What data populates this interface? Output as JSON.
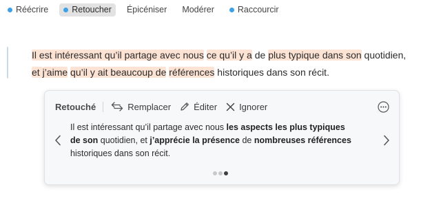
{
  "toolbar": {
    "tabs": [
      {
        "label": "Réécrire",
        "dot": true
      },
      {
        "label": "Retoucher",
        "dot": true,
        "active": true
      },
      {
        "label": "Épicéniser",
        "dot": false
      },
      {
        "label": "Modérer",
        "dot": false
      },
      {
        "label": "Raccourcir",
        "dot": true
      }
    ]
  },
  "paragraph": {
    "l1": {
      "a": "Il est intéressant qu’il partage avec nous",
      "sp": " ",
      "h1": "ce qu’il y a",
      "b": " de ",
      "h2": "plus typique dans son",
      "c": " quotidien,"
    },
    "l2": {
      "a": "et ",
      "h1": "j’aime",
      "b": " ",
      "h2": "qu’il y ait beaucoup de",
      "c": " ",
      "h3": "références",
      "d": " historiques dans son récit."
    }
  },
  "card": {
    "title": "Retouché",
    "actions": {
      "replace": "Remplacer",
      "edit": "Éditer",
      "ignore": "Ignorer"
    },
    "suggestion": {
      "l1a": "Il est intéressant qu’il partage avec nous ",
      "l1b": "les aspects les plus typiques",
      "l2a": "de son",
      "l2b": " quotidien, et ",
      "l2c": "j’apprécie la présence",
      "l2d": " de ",
      "l2e": "nombreuses références",
      "l3": "historiques dans son récit."
    },
    "pager": {
      "total": 3,
      "current": 3
    }
  },
  "colors": {
    "accent": "#3ea1e8",
    "highlight": "#fde3d4"
  },
  "icons": [
    "swap-arrows-icon",
    "pencil-icon",
    "close-x-icon",
    "more-options-icon",
    "chevron-left-icon",
    "chevron-right-icon"
  ]
}
